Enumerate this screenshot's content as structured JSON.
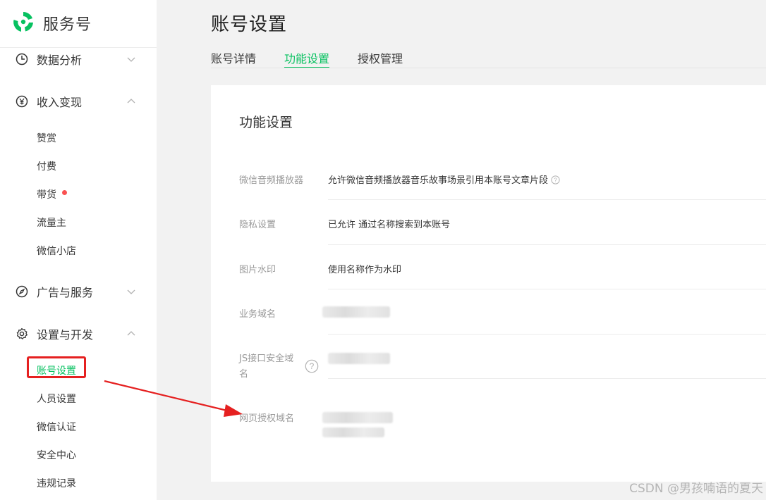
{
  "brand": {
    "name": "服务号",
    "color": "#07c160"
  },
  "sidebar": {
    "groups": [
      {
        "label": "数据分析",
        "icon": "clock-pie-icon",
        "expanded": false
      },
      {
        "label": "收入变现",
        "icon": "yen-circle-icon",
        "expanded": true,
        "items": [
          {
            "label": "赞赏"
          },
          {
            "label": "付费"
          },
          {
            "label": "带货",
            "badge_dot": true
          },
          {
            "label": "流量主"
          },
          {
            "label": "微信小店"
          }
        ]
      },
      {
        "label": "广告与服务",
        "icon": "compass-icon",
        "expanded": false
      },
      {
        "label": "设置与开发",
        "icon": "gear-icon",
        "expanded": true,
        "items": [
          {
            "label": "账号设置",
            "active": true
          },
          {
            "label": "人员设置"
          },
          {
            "label": "微信认证"
          },
          {
            "label": "安全中心"
          },
          {
            "label": "违规记录"
          }
        ]
      }
    ]
  },
  "header": {
    "title": "账号设置",
    "tabs": [
      {
        "label": "账号详情"
      },
      {
        "label": "功能设置",
        "active": true
      },
      {
        "label": "授权管理"
      }
    ]
  },
  "card": {
    "title": "功能设置",
    "rows": [
      {
        "label": "微信音频播放器",
        "value": "允许微信音频播放器音乐故事场景引用本账号文章片段",
        "help_icon": true
      },
      {
        "label": "隐私设置",
        "value": "已允许 通过名称搜索到本账号"
      },
      {
        "label": "图片水印",
        "value": "使用名称作为水印"
      },
      {
        "label": "业务域名",
        "value": ""
      },
      {
        "label": "JS接口安全域名",
        "value": "",
        "help_icon": true
      },
      {
        "label": "网页授权域名",
        "value": ""
      }
    ]
  },
  "annotation": {
    "highlight_color": "#e52020"
  },
  "watermark": "CSDN @男孩喃语的夏天"
}
